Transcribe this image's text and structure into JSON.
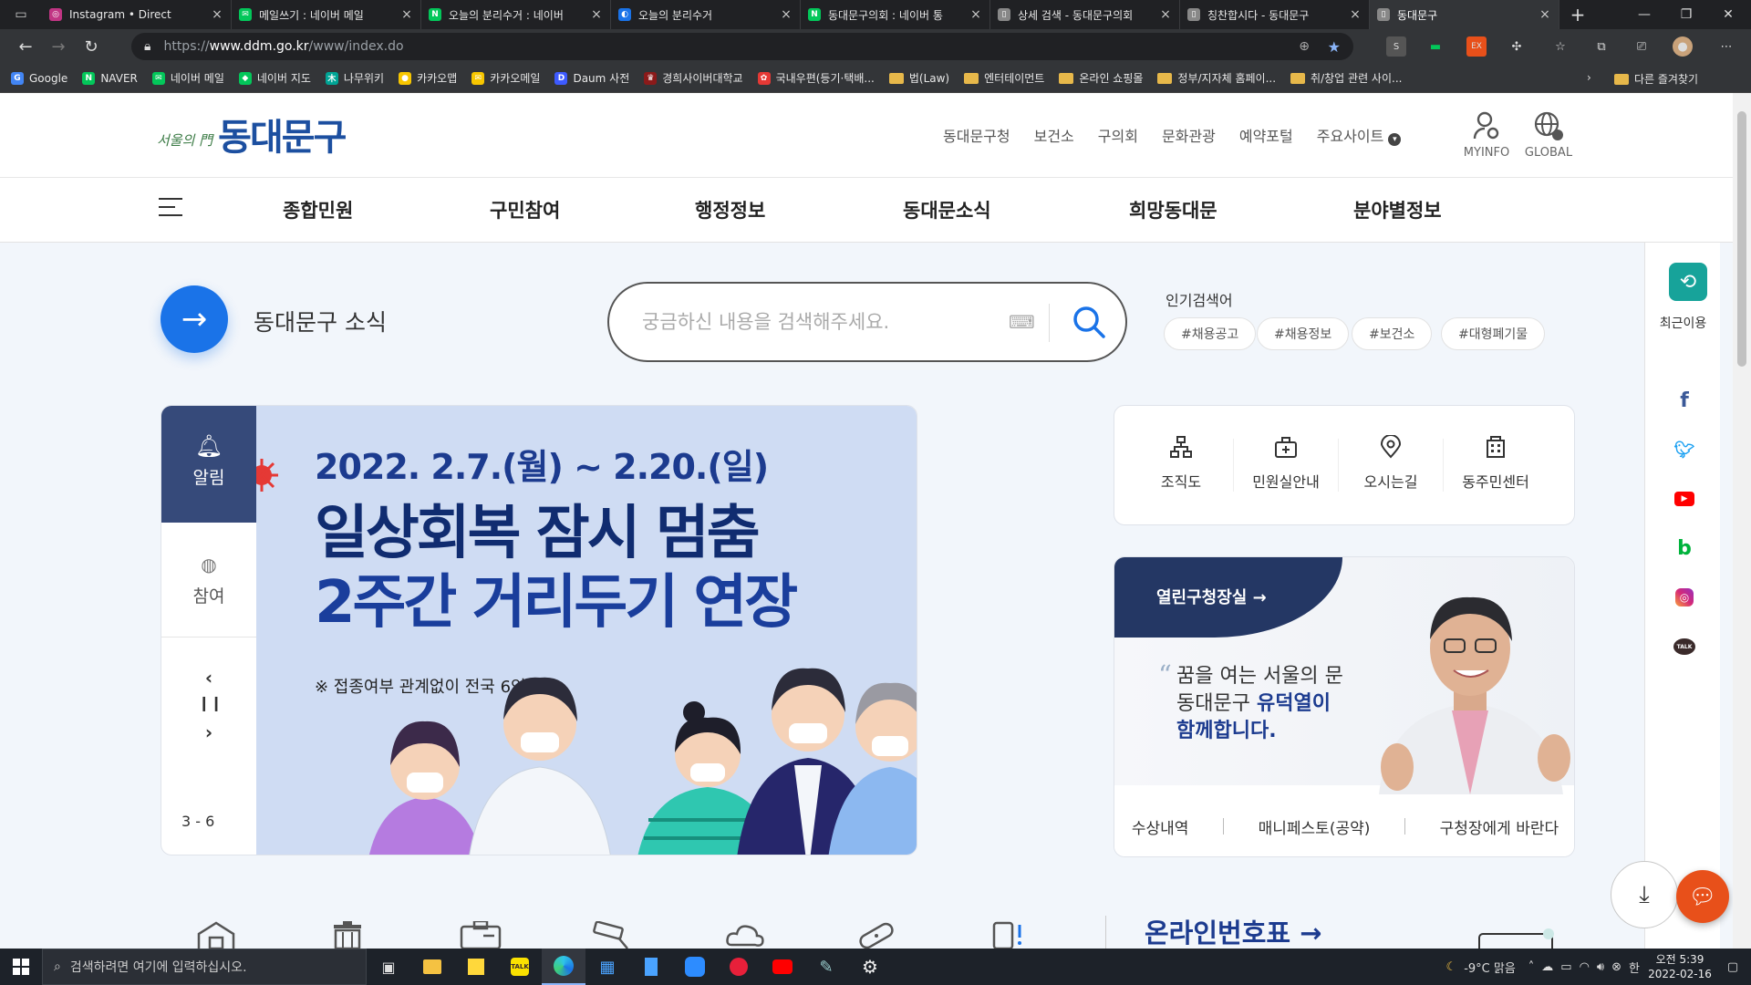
{
  "browser": {
    "tabs": [
      {
        "title": "Instagram • Direct",
        "color": "#c13584",
        "glyph": "◎"
      },
      {
        "title": "메일쓰기 : 네이버 메일",
        "color": "#03c75a",
        "glyph": "✉"
      },
      {
        "title": "오늘의 분리수거 : 네이버 ",
        "color": "#03c75a",
        "glyph": "N"
      },
      {
        "title": "오늘의 분리수거",
        "color": "#1a73e8",
        "glyph": "◐"
      },
      {
        "title": "동대문구의회 : 네이버 통",
        "color": "#03c75a",
        "glyph": "N"
      },
      {
        "title": "상세 검색 - 동대문구의회",
        "color": "#888888",
        "glyph": "▯"
      },
      {
        "title": "칭찬합시다 - 동대문구",
        "color": "#888888",
        "glyph": "▯"
      },
      {
        "title": "동대문구",
        "color": "#888888",
        "glyph": "▯"
      }
    ],
    "url_prefix": "https://",
    "url_host": "www.ddm.go.kr",
    "url_path": "/www/index.do",
    "bookmarks": [
      {
        "label": "Google",
        "type": "site",
        "color": "#4285f4",
        "glyph": "G"
      },
      {
        "label": "NAVER",
        "type": "site",
        "color": "#03c75a",
        "glyph": "N"
      },
      {
        "label": "네이버 메일",
        "type": "site",
        "color": "#03c75a",
        "glyph": "✉"
      },
      {
        "label": "네이버 지도",
        "type": "site",
        "color": "#03c75a",
        "glyph": "◆"
      },
      {
        "label": "나무위키",
        "type": "site",
        "color": "#00a495",
        "glyph": "木"
      },
      {
        "label": "카카오맵",
        "type": "site",
        "color": "#f7c600",
        "glyph": "●"
      },
      {
        "label": "카카오메일",
        "type": "site",
        "color": "#f7c600",
        "glyph": "✉"
      },
      {
        "label": "Daum 사전",
        "type": "site",
        "color": "#3d5afe",
        "glyph": "D"
      },
      {
        "label": "경희사이버대학교",
        "type": "site",
        "color": "#8b1a1a",
        "glyph": "♛"
      },
      {
        "label": "국내우편(등기·택배...",
        "type": "site",
        "color": "#e53935",
        "glyph": "✿"
      },
      {
        "label": "법(Law)",
        "type": "folder"
      },
      {
        "label": "엔터테이먼트",
        "type": "folder"
      },
      {
        "label": "온라인 쇼핑몰",
        "type": "folder"
      },
      {
        "label": "정부/지자체 홈페이...",
        "type": "folder"
      },
      {
        "label": "취/창업 관련 사이...",
        "type": "folder"
      }
    ],
    "other_bookmarks": "다른 즐겨찾기"
  },
  "site": {
    "logo_small": "서울의 門",
    "logo_big": "동대문구",
    "top_links": [
      "동대문구청",
      "보건소",
      "구의회",
      "문화관광",
      "예약포털",
      "주요사이트"
    ],
    "myinfo": "MYINFO",
    "global": "GLOBAL",
    "gnb": [
      "종합민원",
      "구민참여",
      "행정정보",
      "동대문소식",
      "희망동대문",
      "분야별정보"
    ],
    "news_label": "동대문구 소식",
    "search_placeholder": "궁금하신 내용을 검색해주세요.",
    "popular_title": "인기검색어",
    "popular_tags": [
      "#채용공고",
      "#채용정보",
      "#보건소",
      "#대형폐기물"
    ],
    "recent_label": "최근이용",
    "alert_tab": "알림",
    "join_tab": "참여",
    "page_count": "3 - 6",
    "banner": {
      "date": "2022. 2.7.(월) ~ 2.20.(일)",
      "line1": "일상회복 잠시 멈춤",
      "line2": "2주간 거리두기 연장",
      "note": "※ 접종여부 관계없이 전국 6인"
    },
    "quick_menu": [
      "조직도",
      "민원실안내",
      "오시는길",
      "동주민센터"
    ],
    "mayor": {
      "ribbon": "열린구청장실 →",
      "msg1": "꿈을 여는 서울의 문",
      "msg2a": "동대문구 ",
      "msg2b": "유덕열이",
      "msg3": "함께합니다.",
      "links": [
        "수상내역",
        "매니페스토(공약)",
        "구청장에게 바란다"
      ]
    },
    "online_title": "온라인번호표 →"
  },
  "taskbar": {
    "search_placeholder": "검색하려면 여기에 입력하십시오.",
    "weather": "-9°C  맑음",
    "time": "오전 5:39",
    "date": "2022-02-16"
  },
  "colors": {
    "accent": "#1a73e8",
    "navy": "#243764",
    "teal": "#17a39a",
    "chat": "#e8501a"
  }
}
